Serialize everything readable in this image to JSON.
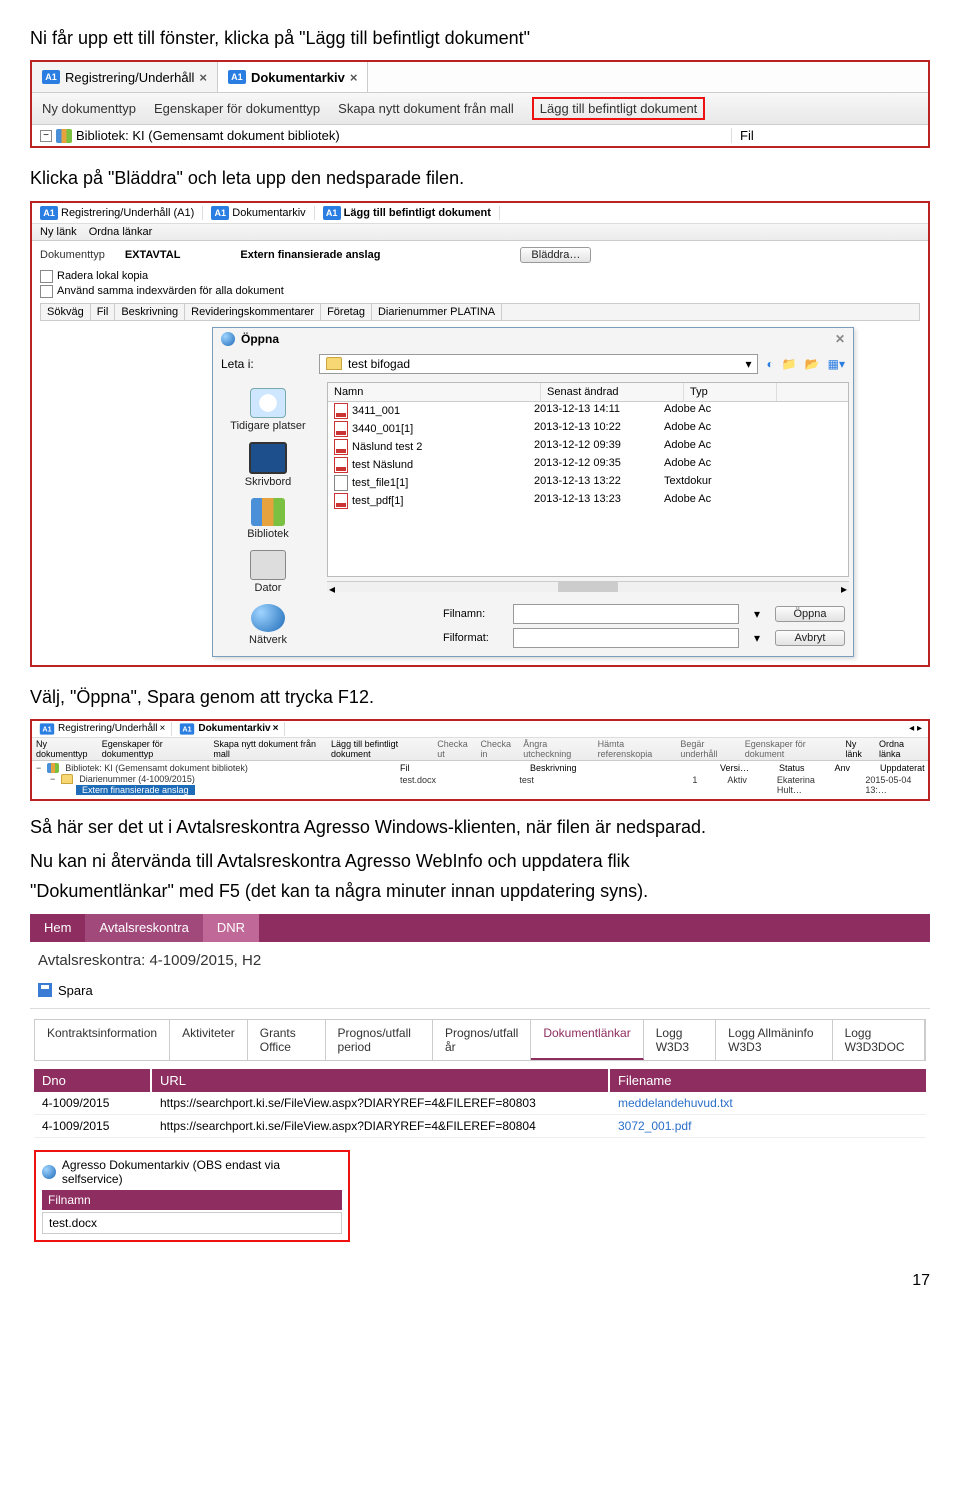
{
  "intro1": "Ni får upp ett till fönster, klicka på \"Lägg till befintligt dokument\"",
  "intro2": "Klicka på \"Bläddra\" och leta upp den nedsparade filen.",
  "intro3": "Välj, \"Öppna\", Spara genom att trycka F12.",
  "intro4": "Så här ser det ut i Avtalsreskontra Agresso Windows-klienten, när filen är nedsparad.",
  "intro5a": "Nu kan ni återvända till Avtalsreskontra Agresso WebInfo och uppdatera flik",
  "intro5b": "\"Dokumentlänkar\" med F5 (det kan ta några minuter innan uppdatering syns).",
  "page_number": "17",
  "shot1": {
    "tab1": "Registrering/Underhåll",
    "tab2": "Dokumentarkiv",
    "toolbar": {
      "new_doctype": "Ny dokumenttyp",
      "props": "Egenskaper för dokumenttyp",
      "create_from_template": "Skapa nytt dokument från mall",
      "add_existing": "Lägg till befintligt dokument"
    },
    "tree_label": "Bibliotek: KI (Gemensamt dokument bibliotek)",
    "fil_header": "Fil"
  },
  "shot2": {
    "tab1": "Registrering/Underhåll (A1)",
    "tab2": "Dokumentarkiv",
    "tab3": "Lägg till befintligt dokument",
    "sub_toolbar": {
      "new_link": "Ny länk",
      "order_links": "Ordna länkar"
    },
    "form": {
      "doctype_label": "Dokumenttyp",
      "doctype_value": "EXTAVTAL",
      "desc": "Extern finansierade anslag",
      "browse": "Bläddra…",
      "chk1": "Radera lokal kopia",
      "chk2": "Använd samma indexvärden för alla dokument"
    },
    "headers": [
      "Sökväg",
      "Fil",
      "Beskrivning",
      "Revideringskommentarer",
      "Företag",
      "Diarienummer PLATINA"
    ],
    "dialog": {
      "title": "Öppna",
      "look_in_label": "Leta i:",
      "look_in_value": "test bifogad",
      "cols": {
        "name": "Namn",
        "date": "Senast ändrad",
        "type": "Typ"
      },
      "rows": [
        {
          "name": "3411_001",
          "date": "2013-12-13 14:11",
          "type": "Adobe Ac",
          "icon": "pdf"
        },
        {
          "name": "3440_001[1]",
          "date": "2013-12-13 10:22",
          "type": "Adobe Ac",
          "icon": "pdf"
        },
        {
          "name": "Näslund test 2",
          "date": "2013-12-12 09:39",
          "type": "Adobe Ac",
          "icon": "pdf"
        },
        {
          "name": "test Näslund",
          "date": "2013-12-12 09:35",
          "type": "Adobe Ac",
          "icon": "pdf"
        },
        {
          "name": "test_file1[1]",
          "date": "2013-12-13 13:22",
          "type": "Textdokur",
          "icon": "txt"
        },
        {
          "name": "test_pdf[1]",
          "date": "2013-12-13 13:23",
          "type": "Adobe Ac",
          "icon": "pdf"
        }
      ],
      "places": [
        "Tidigare platser",
        "Skrivbord",
        "Bibliotek",
        "Dator",
        "Nätverk"
      ],
      "filename_label": "Filnamn:",
      "format_label": "Filformat:",
      "open": "Öppna",
      "cancel": "Avbryt"
    }
  },
  "shot3": {
    "tab1": "Registrering/Underhåll",
    "tab2": "Dokumentarkiv",
    "toolbar": [
      "Ny dokumenttyp",
      "Egenskaper för dokumenttyp",
      "Skapa nytt dokument från mall",
      "Lägg till befintligt dokument",
      "Checka ut",
      "Checka in",
      "Ångra utcheckning",
      "Hämta referenskopia",
      "Begär underhåll",
      "Egenskaper för dokument"
    ],
    "right_links": [
      "Ny länk",
      "Ordna länka"
    ],
    "tree": {
      "root": "Bibliotek: KI (Gemensamt dokument bibliotek)",
      "child": "Diarienummer (4-1009/2015)",
      "leaf": "Extern finansierade anslag"
    },
    "columns": {
      "fil": "Fil",
      "besk": "Beskrivning",
      "versi": "Versi…",
      "status": "Status",
      "anv": "Anv",
      "upd": "Uppdaterat"
    },
    "row": {
      "fil": "test.docx",
      "besk": "test",
      "versi": "1",
      "status": "Aktiv",
      "anv": "Ekaterina Hult…",
      "upd": "2015-05-04 13:…"
    }
  },
  "shot4": {
    "crumbs": [
      "Hem",
      "Avtalsreskontra",
      "DNR"
    ],
    "title": "Avtalsreskontra: 4-1009/2015, H2",
    "save": "Spara",
    "tabs": [
      "Kontraktsinformation",
      "Aktiviteter",
      "Grants Office",
      "Prognos/utfall period",
      "Prognos/utfall år",
      "Dokumentlänkar",
      "Logg W3D3",
      "Logg Allmäninfo W3D3",
      "Logg W3D3DOC"
    ],
    "active_tab": 5,
    "head": {
      "dno": "Dno",
      "url": "URL",
      "file": "Filename"
    },
    "rows": [
      {
        "dno": "4-1009/2015",
        "url": "https://searchport.ki.se/FileView.aspx?DIARYREF=4&FILEREF=80803",
        "file": "meddelandehuvud.txt"
      },
      {
        "dno": "4-1009/2015",
        "url": "https://searchport.ki.se/FileView.aspx?DIARYREF=4&FILEREF=80804",
        "file": "3072_001.pdf"
      }
    ],
    "redbox": {
      "heading": "Agresso Dokumentarkiv (OBS endast via selfservice)",
      "band": "Filnamn",
      "value": "test.docx"
    }
  }
}
